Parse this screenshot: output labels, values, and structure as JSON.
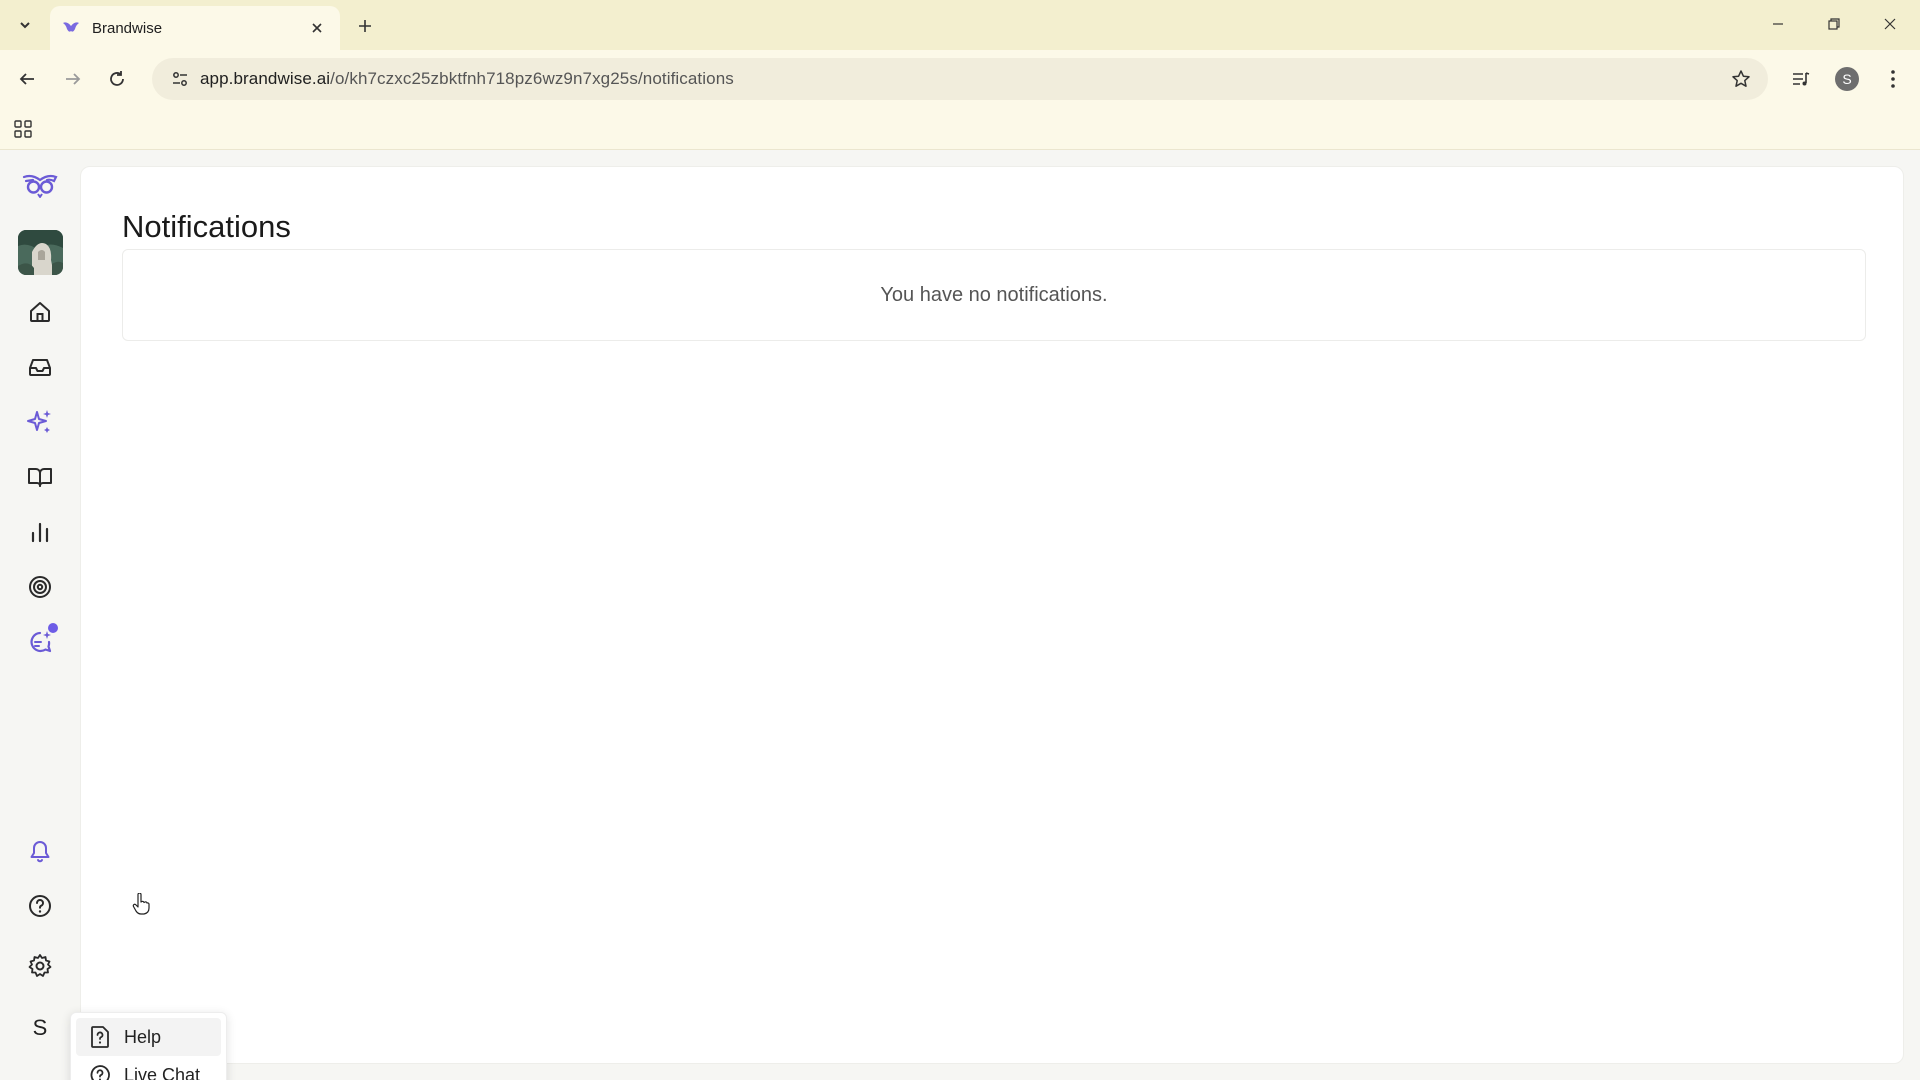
{
  "browser": {
    "tab_title": "Brandwise",
    "url_domain": "app.brandwise.ai",
    "url_path": "/o/kh7czxc25zbktfnh718pz6wz9n7xg25s/notifications",
    "profile_initial": "S"
  },
  "colors": {
    "tabstrip": "#f3efcf",
    "toolbar": "#fcf9e8",
    "accent": "#6d5ce6",
    "brand_purple": "#6b5bd6"
  },
  "sidebar": {
    "items": [
      {
        "name": "logo",
        "icon": "owl-logo-icon"
      },
      {
        "name": "workspace-avatar",
        "icon": "workspace-image"
      },
      {
        "name": "home",
        "icon": "home-icon"
      },
      {
        "name": "inbox",
        "icon": "inbox-icon"
      },
      {
        "name": "ai",
        "icon": "sparkles-icon"
      },
      {
        "name": "knowledge",
        "icon": "book-icon"
      },
      {
        "name": "analytics",
        "icon": "bar-chart-icon"
      },
      {
        "name": "goals",
        "icon": "target-icon"
      },
      {
        "name": "ai-chat",
        "icon": "chat-sparkle-icon",
        "has_dot": true
      },
      {
        "name": "notifications",
        "icon": "bell-icon",
        "active": true
      },
      {
        "name": "help",
        "icon": "help-circle-icon"
      },
      {
        "name": "settings",
        "icon": "gear-icon"
      }
    ],
    "user_initial": "S"
  },
  "main": {
    "title": "Notifications",
    "empty_message": "You have no notifications."
  },
  "help_menu": {
    "items": [
      {
        "label": "Help",
        "icon": "help-square-icon"
      },
      {
        "label": "Live Chat",
        "icon": "chat-bubble-icon"
      }
    ]
  }
}
